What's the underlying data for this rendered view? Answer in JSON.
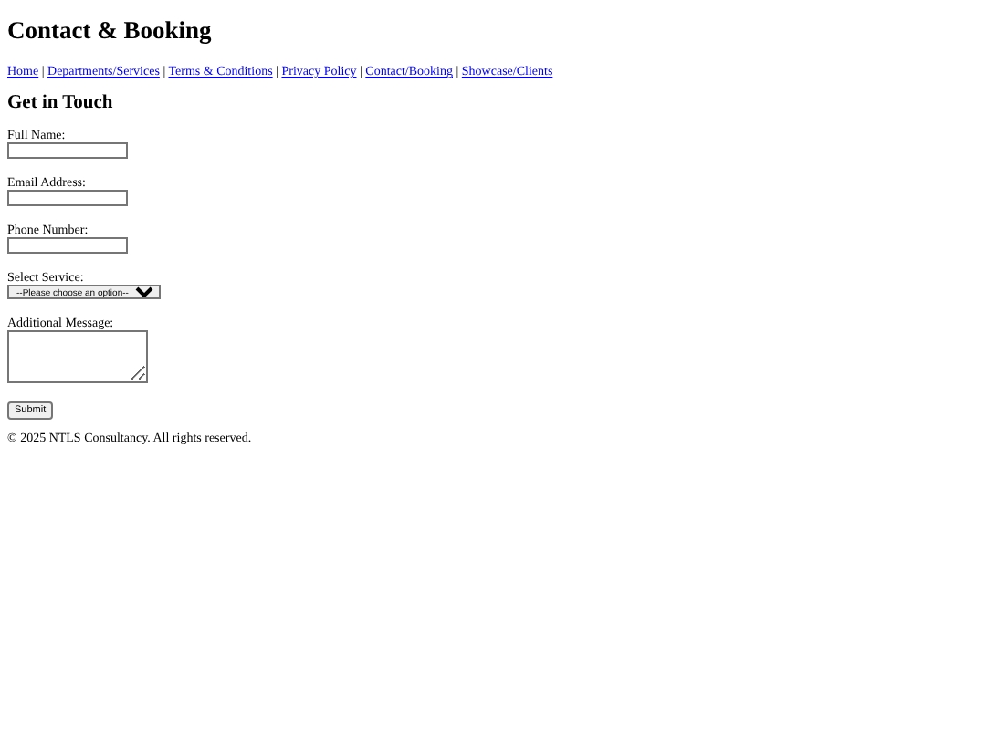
{
  "page": {
    "title": "Contact & Booking"
  },
  "nav": {
    "separator": "|",
    "links": [
      {
        "label": "Home"
      },
      {
        "label": "Departments/Services"
      },
      {
        "label": "Terms & Conditions"
      },
      {
        "label": "Privacy Policy"
      },
      {
        "label": "Contact/Booking"
      },
      {
        "label": "Showcase/Clients"
      }
    ]
  },
  "form": {
    "heading": "Get in Touch",
    "fields": [
      {
        "kind": "text",
        "label": "Full Name:"
      },
      {
        "kind": "text",
        "label": "Email Address:"
      },
      {
        "kind": "text",
        "label": "Phone Number:"
      },
      {
        "kind": "select",
        "label": "Select Service:",
        "value": "--Please choose an option--"
      },
      {
        "kind": "textarea",
        "label": "Additional Message:"
      }
    ],
    "submit": "Submit"
  },
  "footer": "© 2025 NTLS Consultancy. All rights reserved."
}
